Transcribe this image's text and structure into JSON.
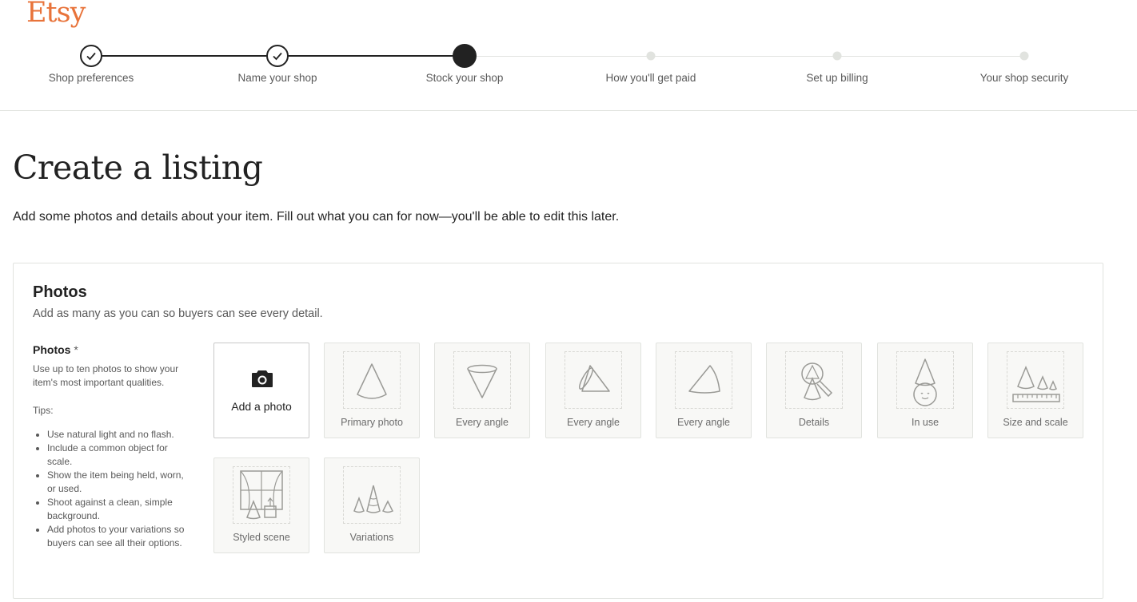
{
  "brand": {
    "logo_text": "Etsy",
    "color": "#e8733a"
  },
  "progress": {
    "steps": [
      {
        "label": "Shop preferences",
        "state": "complete"
      },
      {
        "label": "Name your shop",
        "state": "complete"
      },
      {
        "label": "Stock your shop",
        "state": "current"
      },
      {
        "label": "How you'll get paid",
        "state": "pending"
      },
      {
        "label": "Set up billing",
        "state": "pending"
      },
      {
        "label": "Your shop security",
        "state": "pending"
      }
    ]
  },
  "page": {
    "title": "Create a listing",
    "subtitle": "Add some photos and details about your item. Fill out what you can for now—you'll be able to edit this later."
  },
  "photos": {
    "title": "Photos",
    "subtitle": "Add as many as you can so buyers can see every detail.",
    "field_label": "Photos",
    "required_mark": "*",
    "help": "Use up to ten photos to show your item's most important qualities.",
    "tips_label": "Tips:",
    "tips": [
      "Use natural light and no flash.",
      "Include a common object for scale.",
      "Show the item being held, worn, or used.",
      "Shoot against a clean, simple background.",
      "Add photos to your variations so buyers can see all their options."
    ],
    "add_label": "Add a photo",
    "slots": [
      {
        "label": "Primary photo",
        "icon": "cone-icon"
      },
      {
        "label": "Every angle",
        "icon": "inverted-cone-icon"
      },
      {
        "label": "Every angle",
        "icon": "tilted-cone-icon"
      },
      {
        "label": "Every angle",
        "icon": "side-cone-icon"
      },
      {
        "label": "Details",
        "icon": "magnifier-cone-icon"
      },
      {
        "label": "In use",
        "icon": "cone-hat-face-icon"
      },
      {
        "label": "Size and scale",
        "icon": "ruler-cones-icon"
      },
      {
        "label": "Styled scene",
        "icon": "window-scene-icon"
      },
      {
        "label": "Variations",
        "icon": "three-cones-icon"
      }
    ]
  }
}
